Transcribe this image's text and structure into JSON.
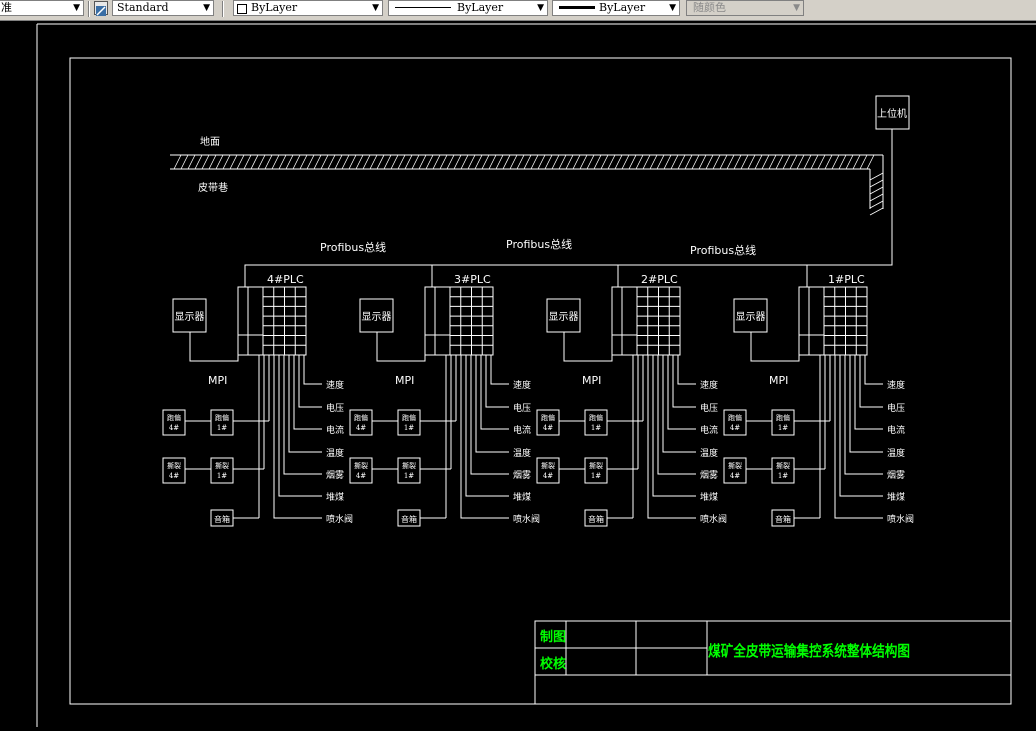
{
  "toolbar": {
    "text_style_partial": "准",
    "dim_style": "Standard",
    "layer": "ByLayer",
    "linetype": "ByLayer",
    "lineweight": "ByLayer",
    "plot_style": "随颜色"
  },
  "drawing": {
    "ground_label": "地面",
    "belt_label": "皮带巷",
    "host_label": "上位机",
    "bus_labels": [
      "Profibus总线",
      "Profibus总线",
      "Profibus总线"
    ],
    "stations": [
      {
        "plc": "4#PLC",
        "display": "显示器",
        "mpi": "MPI",
        "sensors": [
          "速度",
          "电压",
          "电流",
          "温度",
          "烟雾",
          "堆煤",
          "喷水阀"
        ],
        "devices": [
          "跑偏\n4#",
          "跑偏\n1#",
          "撕裂\n4#",
          "撕裂\n1#",
          "音箱"
        ]
      },
      {
        "plc": "3#PLC",
        "display": "显示器",
        "mpi": "MPI",
        "sensors": [
          "速度",
          "电压",
          "电流",
          "温度",
          "烟雾",
          "堆煤",
          "喷水阀"
        ],
        "devices": [
          "跑偏\n4#",
          "跑偏\n1#",
          "撕裂\n4#",
          "撕裂\n1#",
          "音箱"
        ]
      },
      {
        "plc": "2#PLC",
        "display": "显示器",
        "mpi": "MPI",
        "sensors": [
          "速度",
          "电压",
          "电流",
          "温度",
          "烟雾",
          "堆煤",
          "喷水阀"
        ],
        "devices": [
          "跑偏\n4#",
          "跑偏\n1#",
          "撕裂\n4#",
          "撕裂\n1#",
          "音箱"
        ]
      },
      {
        "plc": "1#PLC",
        "display": "显示器",
        "mpi": "MPI",
        "sensors": [
          "速度",
          "电压",
          "电流",
          "温度",
          "烟雾",
          "堆煤",
          "喷水阀"
        ],
        "devices": [
          "跑偏\n4#",
          "跑偏\n1#",
          "撕裂\n4#",
          "撕裂\n1#",
          "音箱"
        ]
      }
    ]
  },
  "title_block": {
    "drawn_label": "制图",
    "checked_label": "校核",
    "title": "煤矿全皮带运输集控系统整体结构图"
  },
  "colors": {
    "background": "#000000",
    "lines": "#ffffff",
    "title_text": "#00ff00"
  }
}
